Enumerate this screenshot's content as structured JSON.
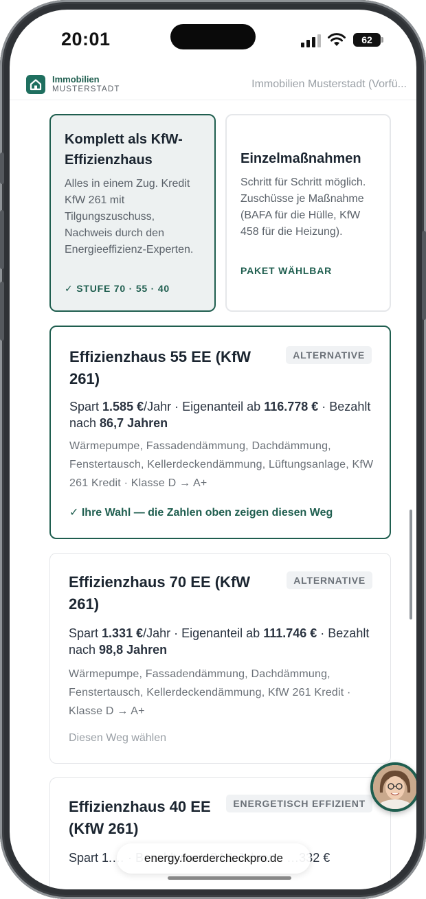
{
  "status_bar": {
    "time": "20:01",
    "battery": "62"
  },
  "header": {
    "logo_name": "Immobilien",
    "logo_sub": "MUSTERSTADT",
    "title": "Immobilien Musterstadt (Vorfü..."
  },
  "options": [
    {
      "title": "Komplett als KfW-Effizienzhaus",
      "body": "Alles in einem Zug. Kredit KfW 261 mit Tilgungszuschuss, Nachweis durch den Energieeffizienz-Experten.",
      "tag": "✓ STUFE 70 · 55 · 40"
    },
    {
      "title": "Einzelmaßnahmen",
      "body": "Schritt für Schritt möglich. Zuschüsse je Maßnahme (BAFA für die Hülle, KfW 458 für die Heizung).",
      "tag": "PAKET WÄHLBAR"
    }
  ],
  "routes": [
    {
      "title": "Effizienzhaus 55 EE (KfW 261)",
      "badge": "ALTERNATIVE",
      "savings_prefix": "Spart ",
      "savings": "1.585 €",
      "savings_suffix": "/Jahr · Eigenanteil ab ",
      "own_share": "116.778 €",
      "payback_prefix": " · Bezahlt nach ",
      "payback": "86,7 Jahren",
      "measures": "Wärmepumpe, Fassadendämmung, Dachdämmung, Fenstertausch, Kellerdeckendämmung, Lüftungsanlage, KfW 261 Kredit · Klasse D → A+",
      "choice": "✓ Ihre Wahl — die Zahlen oben zeigen diesen Weg"
    },
    {
      "title": "Effizienzhaus 70 EE (KfW 261)",
      "badge": "ALTERNATIVE",
      "savings_prefix": "Spart ",
      "savings": "1.331 €",
      "savings_suffix": "/Jahr · Eigenanteil ab ",
      "own_share": "111.746 €",
      "payback_prefix": " · Bezahlt nach ",
      "payback": "98,8 Jahren",
      "measures": "Wärmepumpe, Fassadendämmung, Dachdämmung, Fenstertausch, Kellerdeckendämmung, KfW 261 Kredit · Klasse D → A+",
      "choice": "Diesen Weg wählen"
    },
    {
      "title": "Effizienzhaus 40 EE (KfW 261)",
      "badge": "ENERGETISCH EFFIZIENT",
      "stats_visible": "Spart 1.… · Bezahlt nach 84,1 Jahren · …332 €"
    }
  ],
  "browser": {
    "url": "energy.foerdercheckpro.de"
  }
}
